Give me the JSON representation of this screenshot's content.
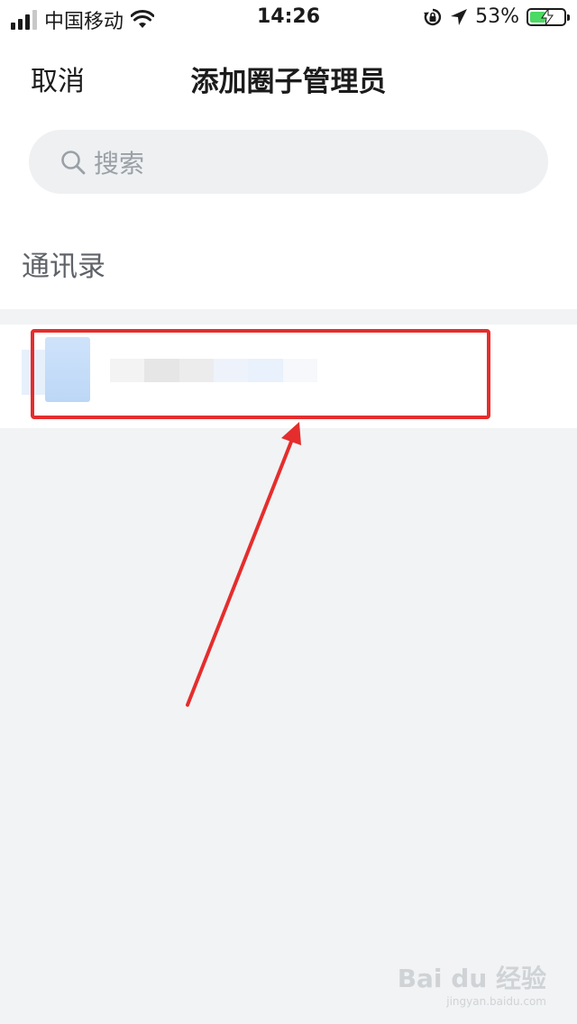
{
  "status_bar": {
    "carrier": "中国移动",
    "time": "14:26",
    "battery_percent": "53%",
    "battery_level": 0.53,
    "icons": [
      "signal-icon",
      "wifi-icon",
      "rotation-lock-icon",
      "location-icon",
      "battery-charging-icon"
    ]
  },
  "nav": {
    "cancel_label": "取消",
    "title": "添加圈子管理员"
  },
  "search": {
    "placeholder": "搜索"
  },
  "section": {
    "contacts_label": "通讯录"
  },
  "contacts": [
    {
      "name": "",
      "avatar": "blurred"
    }
  ],
  "annotation": {
    "highlight_color": "#e52d2d"
  },
  "watermark": {
    "main": "Bai du 经验",
    "sub": "jingyan.baidu.com"
  },
  "colors": {
    "background": "#f1f3f4",
    "surface": "#ffffff",
    "search_bg": "#eef0f2",
    "text_primary": "#1b1b1b",
    "text_secondary": "#5f6368",
    "placeholder": "#9aa0a6",
    "battery_fill": "#4cd964"
  }
}
